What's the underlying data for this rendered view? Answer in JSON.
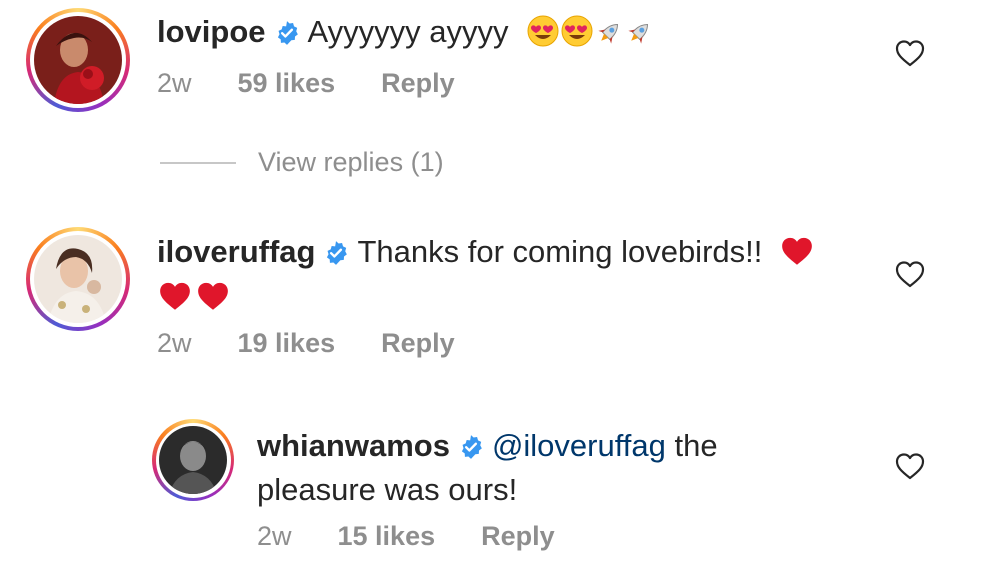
{
  "comments": [
    {
      "username": "lovipoe",
      "text": "Ayyyyyy ayyyy",
      "emojis": [
        "heart-eyes-emoji",
        "heart-eyes-emoji",
        "rocket-emoji",
        "rocket-emoji"
      ],
      "time": "2w",
      "likes": "59 likes",
      "reply": "Reply"
    },
    {
      "username": "iloveruffag",
      "text": "Thanks for coming lovebirds!!",
      "emojis": [
        "red-heart-emoji",
        "red-heart-emoji",
        "red-heart-emoji"
      ],
      "time": "2w",
      "likes": "19 likes",
      "reply": "Reply"
    },
    {
      "username": "whianwamos",
      "mention": "@iloveruffag",
      "text_line1": "the",
      "text_line2": "pleasure was ours!",
      "time": "2w",
      "likes": "15 likes",
      "reply": "Reply"
    }
  ],
  "view_replies": "View replies (1)",
  "colors": {
    "text": "#262626",
    "meta": "#8e8e8e",
    "mention": "#00376b",
    "verified": "#3897f0"
  }
}
